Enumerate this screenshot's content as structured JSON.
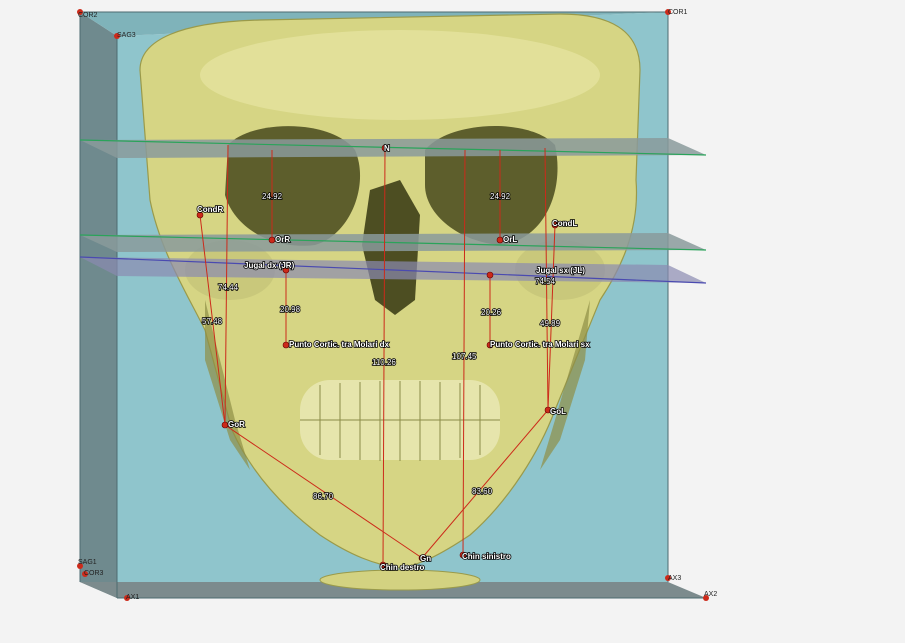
{
  "view": {
    "box_color": "#8fc5cc",
    "skull_color": "#d8d88a",
    "measurement_color": "#cc2a1a",
    "plane_green": "#2aa35a",
    "plane_blue": "#4a4ab0"
  },
  "corners": {
    "cor2": "COR2",
    "cor1": "COR1",
    "sag3": "SAG3",
    "sag1": "SAG1",
    "cor3": "COR3",
    "ax1": "AX1",
    "ax3": "AX3",
    "ax2": "AX2"
  },
  "landmarks": {
    "n": "N",
    "cond_r": "CondR",
    "cond_l": "CondL",
    "or_r": "OrR",
    "or_l": "OrL",
    "jugal_dx": "Jugal dx (JR)",
    "jugal_sx": "Jugal sx (JL)",
    "cort_dx": "Punto Cortic. tra Molari dx",
    "cort_sx": "Punto Cortic. tra Molari sx",
    "go_r": "GoR",
    "go_l": "GoL",
    "gn": "Gn",
    "chin_dx": "Chin destro",
    "chin_sx": "Chin sinistro"
  },
  "measurements": {
    "or_r_height": "24.92",
    "or_l_height": "24.92",
    "cond_r_height": "74.44",
    "cond_l_height": "74.54",
    "go_r_height": "57.48",
    "go_l_height": "49.89",
    "jugal_r_height": "20.98",
    "jugal_l_height": "20.26",
    "n_chin_dx": "110.26",
    "n_chin_sx": "107.45",
    "go_r_gn": "86.70",
    "go_l_gn": "83.60"
  }
}
